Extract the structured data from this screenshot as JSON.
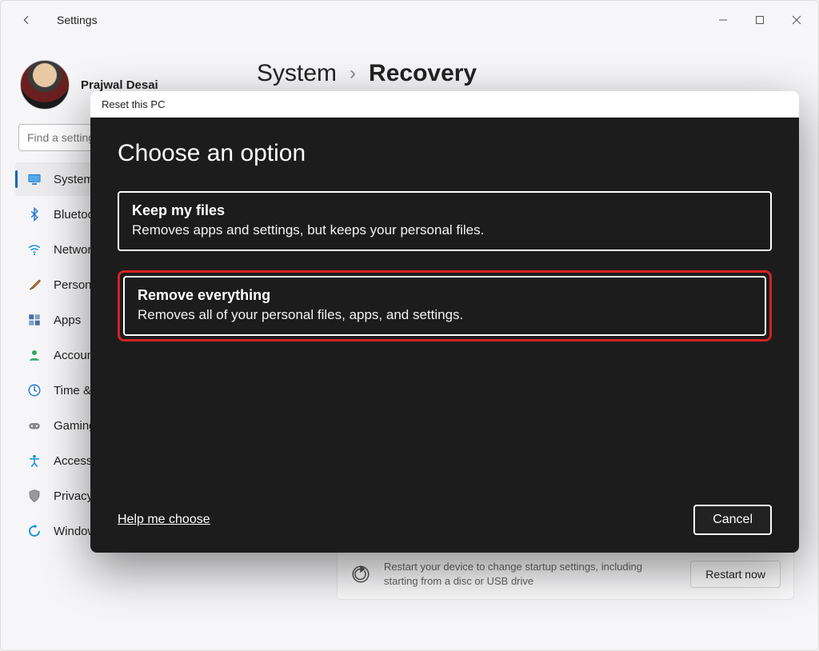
{
  "app_title": "Settings",
  "profile": {
    "name": "Prajwal Desai"
  },
  "search_placeholder": "Find a setting",
  "breadcrumb": {
    "root": "System",
    "current": "Recovery"
  },
  "sidebar": {
    "items": [
      {
        "label": "System"
      },
      {
        "label": "Bluetooth & devices"
      },
      {
        "label": "Network & internet"
      },
      {
        "label": "Personalization"
      },
      {
        "label": "Apps"
      },
      {
        "label": "Accounts"
      },
      {
        "label": "Time & language"
      },
      {
        "label": "Gaming"
      },
      {
        "label": "Accessibility"
      },
      {
        "label": "Privacy & security"
      },
      {
        "label": "Windows Update"
      }
    ]
  },
  "advanced_startup": {
    "desc": "Restart your device to change startup settings, including starting from a disc or USB drive",
    "button": "Restart now"
  },
  "modal": {
    "title": "Reset this PC",
    "heading": "Choose an option",
    "option1": {
      "title": "Keep my files",
      "desc": "Removes apps and settings, but keeps your personal files."
    },
    "option2": {
      "title": "Remove everything",
      "desc": "Removes all of your personal files, apps, and settings."
    },
    "help": "Help me choose",
    "cancel": "Cancel"
  }
}
